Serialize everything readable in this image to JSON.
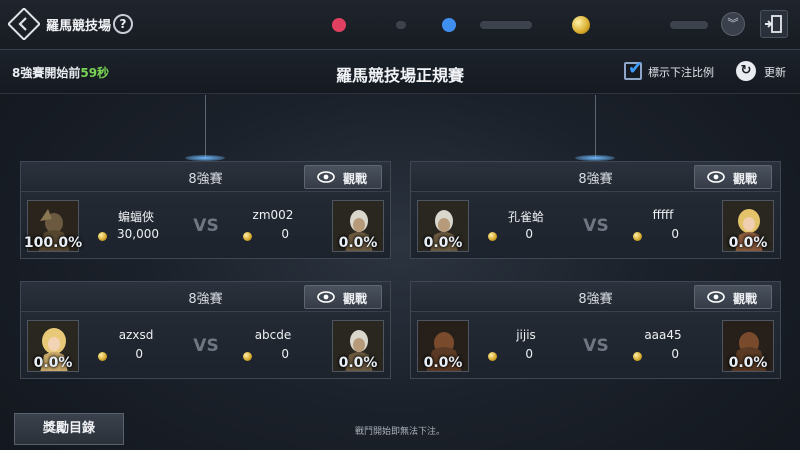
{
  "header": {
    "title": "羅馬競技場",
    "help_label": "?",
    "currencies": [
      {
        "icon": "ruby-icon",
        "color": "#e0405f"
      },
      {
        "icon": "gem-icon",
        "color": "#3f8ff0"
      },
      {
        "icon": "gold-coin-icon",
        "color": "#d9ac2d"
      }
    ]
  },
  "subheader": {
    "countdown_prefix": "8強賽開始前",
    "countdown_seconds": "59秒",
    "title": "羅馬競技場正規賽",
    "show_odds_label": "標示下注比例",
    "show_odds_checked": true,
    "refresh_label": "更新"
  },
  "matches": [
    {
      "round": "8強賽",
      "watch": "觀戰",
      "left": {
        "name": "蝙蝠俠",
        "bet": "30,000",
        "pct": "100.0%"
      },
      "right": {
        "name": "zm002",
        "bet": "0",
        "pct": "0.0%"
      },
      "vs": "VS"
    },
    {
      "round": "8強賽",
      "watch": "觀戰",
      "left": {
        "name": "孔雀蛤",
        "bet": "0",
        "pct": "0.0%"
      },
      "right": {
        "name": "fffff",
        "bet": "0",
        "pct": "0.0%"
      },
      "vs": "VS"
    },
    {
      "round": "8強賽",
      "watch": "觀戰",
      "left": {
        "name": "azxsd",
        "bet": "0",
        "pct": "0.0%"
      },
      "right": {
        "name": "abcde",
        "bet": "0",
        "pct": "0.0%"
      },
      "vs": "VS"
    },
    {
      "round": "8強賽",
      "watch": "觀戰",
      "left": {
        "name": "jijis",
        "bet": "0",
        "pct": "0.0%"
      },
      "right": {
        "name": "aaa45",
        "bet": "0",
        "pct": "0.0%"
      },
      "vs": "VS"
    }
  ],
  "footer": {
    "reward_button": "獎勵目錄",
    "notice": "戰鬥開始即無法下注。"
  }
}
